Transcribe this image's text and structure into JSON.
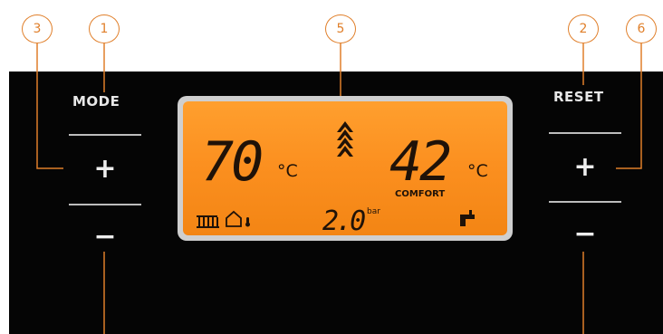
{
  "callouts": {
    "c1": "1",
    "c2": "2",
    "c3": "3",
    "c5": "5",
    "c6": "6"
  },
  "left_controls": {
    "mode_label": "MODE",
    "plus": "+",
    "minus": "−"
  },
  "right_controls": {
    "reset_label": "RESET",
    "plus": "+",
    "minus": "−"
  },
  "display": {
    "heating_temp": "70",
    "heating_unit": "°C",
    "dhw_temp": "42",
    "dhw_unit": "°C",
    "mode_text": "COMFORT",
    "pressure": "2.0",
    "pressure_unit": "bar"
  },
  "colors": {
    "callout_accent": "#e07f2a",
    "lcd_backlight": "#fb8f1f",
    "panel": "#050505"
  },
  "icons": [
    "radiator-icon",
    "house-icon",
    "flame-icon",
    "tap-icon"
  ]
}
